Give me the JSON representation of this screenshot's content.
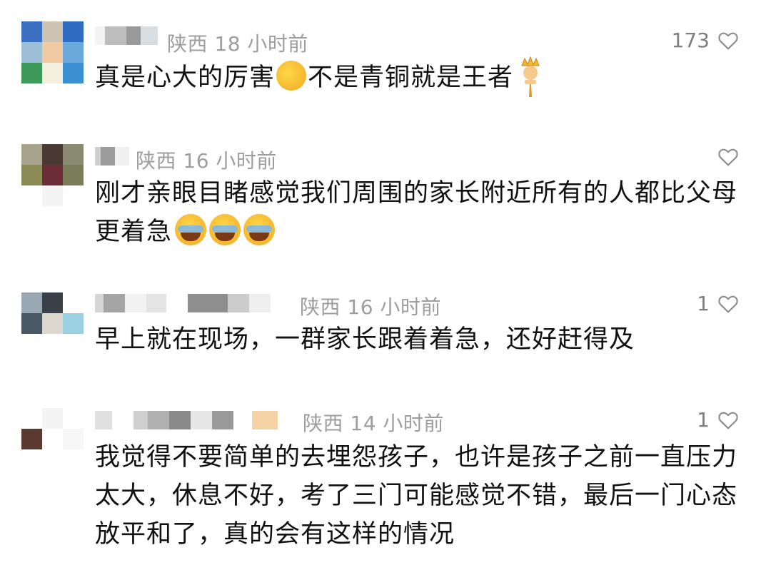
{
  "comments": [
    {
      "location_time": "陕西 18 小时前",
      "likes": "173",
      "text_a": "真是心大的厉害",
      "text_b": "不是青铜就是王者",
      "avatar_colors": [
        "#3a6fc2",
        "#cfc4b1",
        "#2f6cc0",
        "#9dbfd6",
        "#f1c9a3",
        "#6aa9d9",
        "#3e9a5a",
        "#f5f0de",
        "#3c8fd0"
      ],
      "emojis": [
        "thumbs-up-icon",
        "crown-person-icon"
      ]
    },
    {
      "location_time": "陕西 16 小时前",
      "likes": "",
      "text_a": "刚才亲眼目睹感觉我们周围的家长附近所有的人都比父母更着急",
      "avatar_colors": [
        "#a8a48c",
        "#4a3a33",
        "#8a8a72",
        "#8a8b55",
        "#6b2e38",
        "#7a7c5a",
        "#ffffff",
        "#ffffff",
        "#ffffff"
      ],
      "emojis": [
        "crying-face-icon",
        "crying-face-icon",
        "crying-face-icon"
      ]
    },
    {
      "location_time": "陕西 16 小时前",
      "likes": "1",
      "text_a": "早上就在现场，一群家长跟着着急，还好赶得及",
      "avatar_colors": [
        "#9aa8b4",
        "#3a4048",
        "#ffffff",
        "#4a5866",
        "#dcd8d0",
        "#9bd0e0",
        "#ffffff",
        "#ffffff",
        "#ffffff"
      ],
      "emojis": []
    },
    {
      "location_time": "陕西 14 小时前",
      "likes": "1",
      "text_a": "我觉得不要简单的去埋怨孩子，也许是孩子之前一直压力太大，休息不好，考了三门可能感觉不错，最后一门心态放平和了，真的会有这样的情况",
      "avatar_colors": [
        "#ffffff",
        "#ffffff",
        "#ffffff",
        "#5a3a2e",
        "#ffffff",
        "#ffffff",
        "#ffffff",
        "#ffffff",
        "#ffffff"
      ],
      "emojis": []
    }
  ],
  "colors": {
    "meta": "#9e9e9e",
    "text": "#111111",
    "heart": "#8a8a8a"
  }
}
